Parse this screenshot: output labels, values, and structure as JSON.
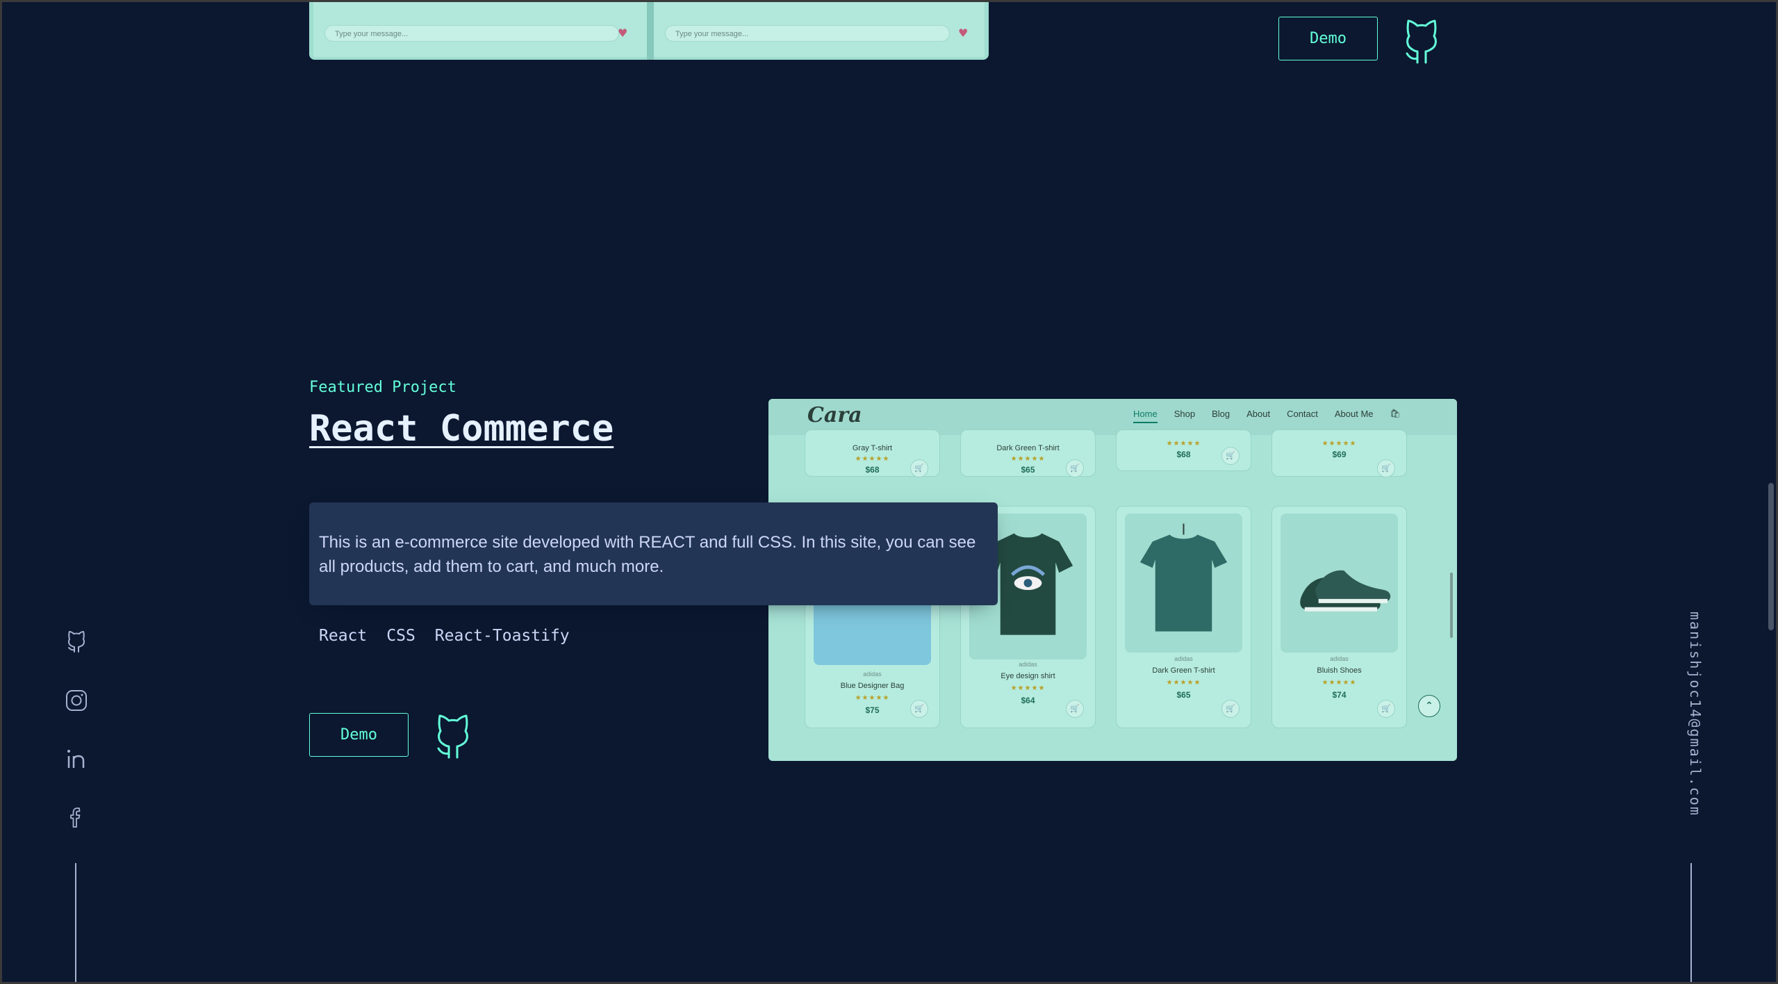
{
  "previous_project": {
    "message_placeholder_left": "Type your message...",
    "message_placeholder_right": "Type your message...",
    "demo_label": "Demo"
  },
  "project": {
    "overline": "Featured Project",
    "title": "React Commerce",
    "description": "This is an e-commerce site developed with REACT and full CSS. In this site, you can see all products, add them to cart, and much more.",
    "tech": [
      "React",
      "CSS",
      "React-Toastify"
    ],
    "demo_label": "Demo"
  },
  "screenshot": {
    "logo": "Cara",
    "nav": [
      "Home",
      "Shop",
      "Blog",
      "About",
      "Contact",
      "About Me"
    ],
    "top_row": [
      {
        "name": "Gray T-shirt",
        "price": "$68"
      },
      {
        "name": "Dark Green T-shirt",
        "price": "$65"
      },
      {
        "name": "",
        "price": "$68"
      },
      {
        "name": "",
        "price": "$69"
      }
    ],
    "bottom_row": [
      {
        "brand": "adidas",
        "name": "Blue Designer Bag",
        "price": "$75"
      },
      {
        "brand": "adidas",
        "name": "Eye design shirt",
        "price": "$64"
      },
      {
        "brand": "adidas",
        "name": "Dark Green T-shirt",
        "price": "$65"
      },
      {
        "brand": "adidas",
        "name": "Bluish Shoes",
        "price": "$74"
      }
    ],
    "stars": "★★★★★"
  },
  "sidebar": {
    "email": "manishjoc14@gmail.com"
  },
  "colors": {
    "background": "#0b1830",
    "accent": "#64ffda",
    "card": "#233554"
  }
}
